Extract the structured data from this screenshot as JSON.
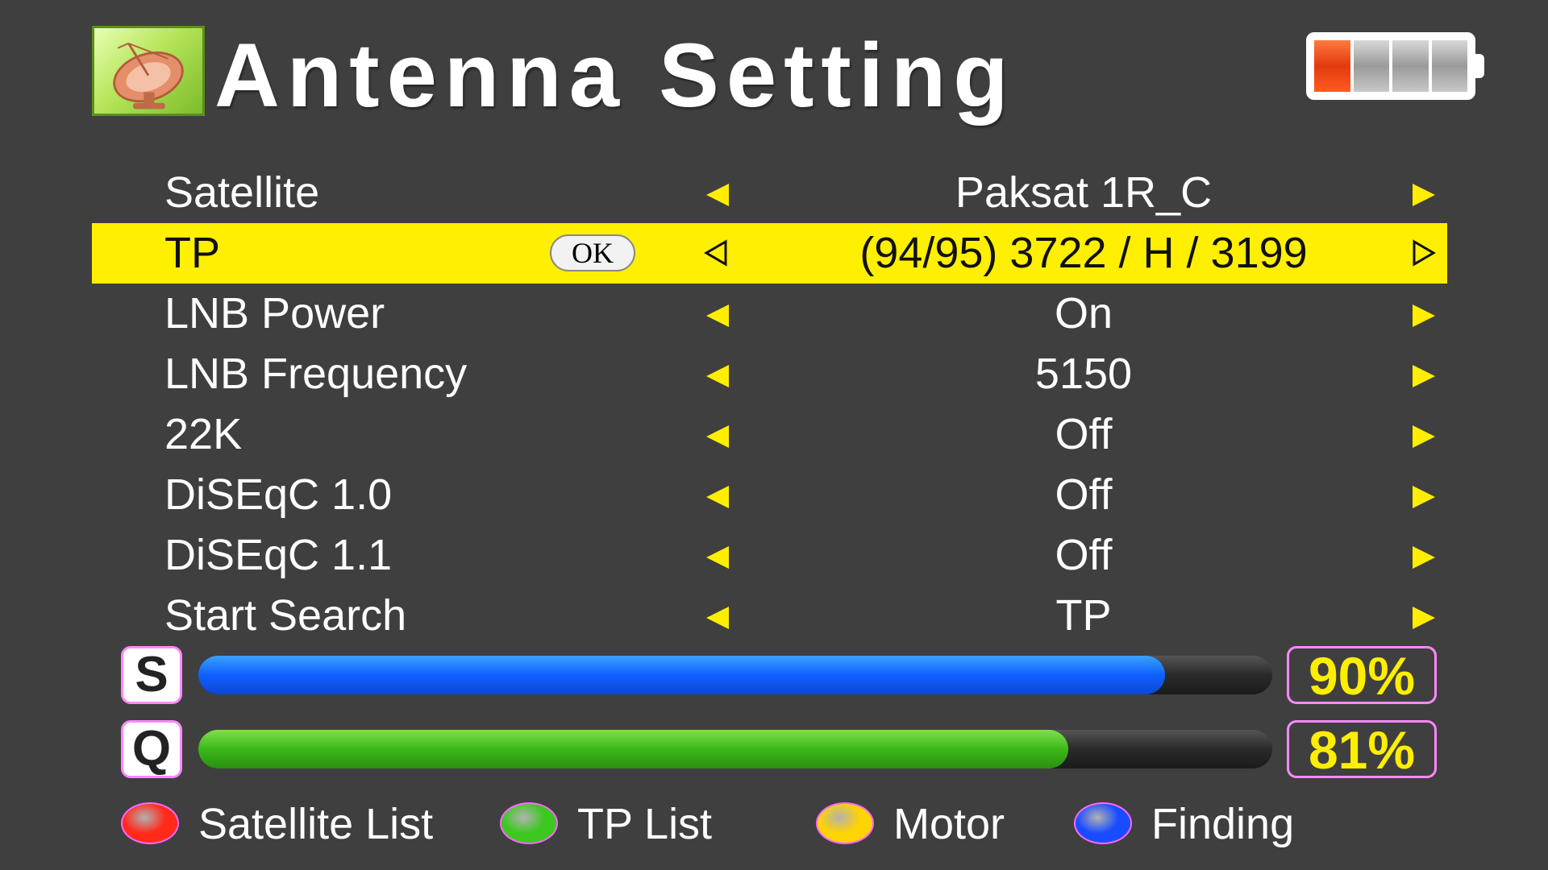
{
  "header": {
    "title": "Antenna Setting",
    "icon": "satellite-dish-icon",
    "battery": {
      "level": 0.25,
      "bars_total": 4,
      "bars_filled": 1
    }
  },
  "menu": {
    "rows": [
      {
        "label": "Satellite",
        "value": "Paksat 1R_C"
      },
      {
        "label": "TP",
        "value": "(94/95) 3722 / H / 3199",
        "ok_label": "OK",
        "selected": true
      },
      {
        "label": "LNB Power",
        "value": "On"
      },
      {
        "label": "LNB Frequency",
        "value": "5150"
      },
      {
        "label": "22K",
        "value": "Off"
      },
      {
        "label": "DiSEqC 1.0",
        "value": "Off"
      },
      {
        "label": "DiSEqC 1.1",
        "value": "Off"
      },
      {
        "label": "Start Search",
        "value": "TP"
      }
    ]
  },
  "signal": {
    "strength": {
      "badge": "S",
      "percent_label": "90%",
      "value": 90,
      "color": "#1060ff"
    },
    "quality": {
      "badge": "Q",
      "percent_label": "81%",
      "value": 81,
      "color": "#3cb81a"
    }
  },
  "legend": [
    {
      "color": "#ff2a1a",
      "label": "Satellite List"
    },
    {
      "color": "#3cc820",
      "label": "TP List"
    },
    {
      "color": "#ffd400",
      "label": "Motor"
    },
    {
      "color": "#1a4cff",
      "label": "Finding"
    }
  ],
  "colors": {
    "background": "#3f3f3f",
    "highlight": "#ffef00",
    "arrow": "#ffee00",
    "frame": "#ff88ff"
  }
}
